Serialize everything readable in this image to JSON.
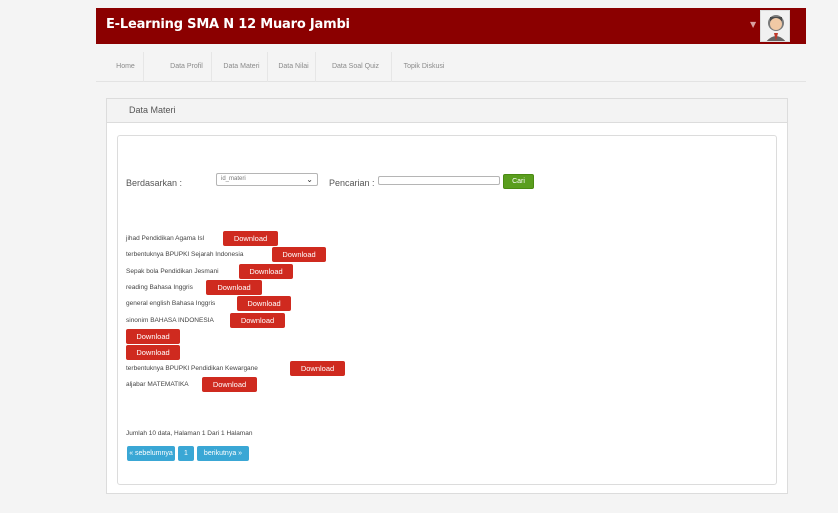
{
  "app": {
    "title": "E-Learning SMA N 12 Muaro Jambi"
  },
  "nav": {
    "items": [
      {
        "label": "Home"
      },
      {
        "label": "Data Profil"
      },
      {
        "label": "Data Materi"
      },
      {
        "label": "Data Nilai"
      },
      {
        "label": "Data Soal Quiz"
      },
      {
        "label": "Topik Diskusi"
      }
    ]
  },
  "panel": {
    "title": "Data Materi"
  },
  "filter": {
    "by_label": "Berdasarkan :",
    "by_value": "id_materi",
    "search_label": "Pencarian :",
    "search_value": "",
    "search_button": "Cari"
  },
  "materials": [
    {
      "title": "jihad",
      "subject": "Pendidikan Agama Isl",
      "button": "Download"
    },
    {
      "title": "terbentuknya BPUPKI",
      "subject": "Sejarah Indonesia",
      "button": "Download"
    },
    {
      "title": "Sepak bola",
      "subject": "Pendidikan Jesmani",
      "button": "Download"
    },
    {
      "title": "reading",
      "subject": "Bahasa Inggris",
      "button": "Download"
    },
    {
      "title": "general english",
      "subject": "Bahasa Inggris",
      "button": "Download"
    },
    {
      "title": "sinonim",
      "subject": "BAHASA INDONESIA",
      "button": "Download"
    },
    {
      "title": "",
      "subject": "",
      "button": "Download"
    },
    {
      "title": "",
      "subject": "",
      "button": "Download"
    },
    {
      "title": "terbentuknya BPUPKI",
      "subject": "Pendidikan Kewargane",
      "button": "Download"
    },
    {
      "title": "aljabar",
      "subject": "MATEMATIKA",
      "button": "Download"
    }
  ],
  "summary": "Jumlah 10 data, Halaman 1 Dari 1 Halaman",
  "pagination": {
    "prev": "« sebelumnya",
    "current": "1",
    "next": "berikutnya »"
  },
  "colors": {
    "header": "#8b0000",
    "download": "#cf2a1f",
    "search_button": "#5a9e1e",
    "pager": "#3aa7d5"
  }
}
